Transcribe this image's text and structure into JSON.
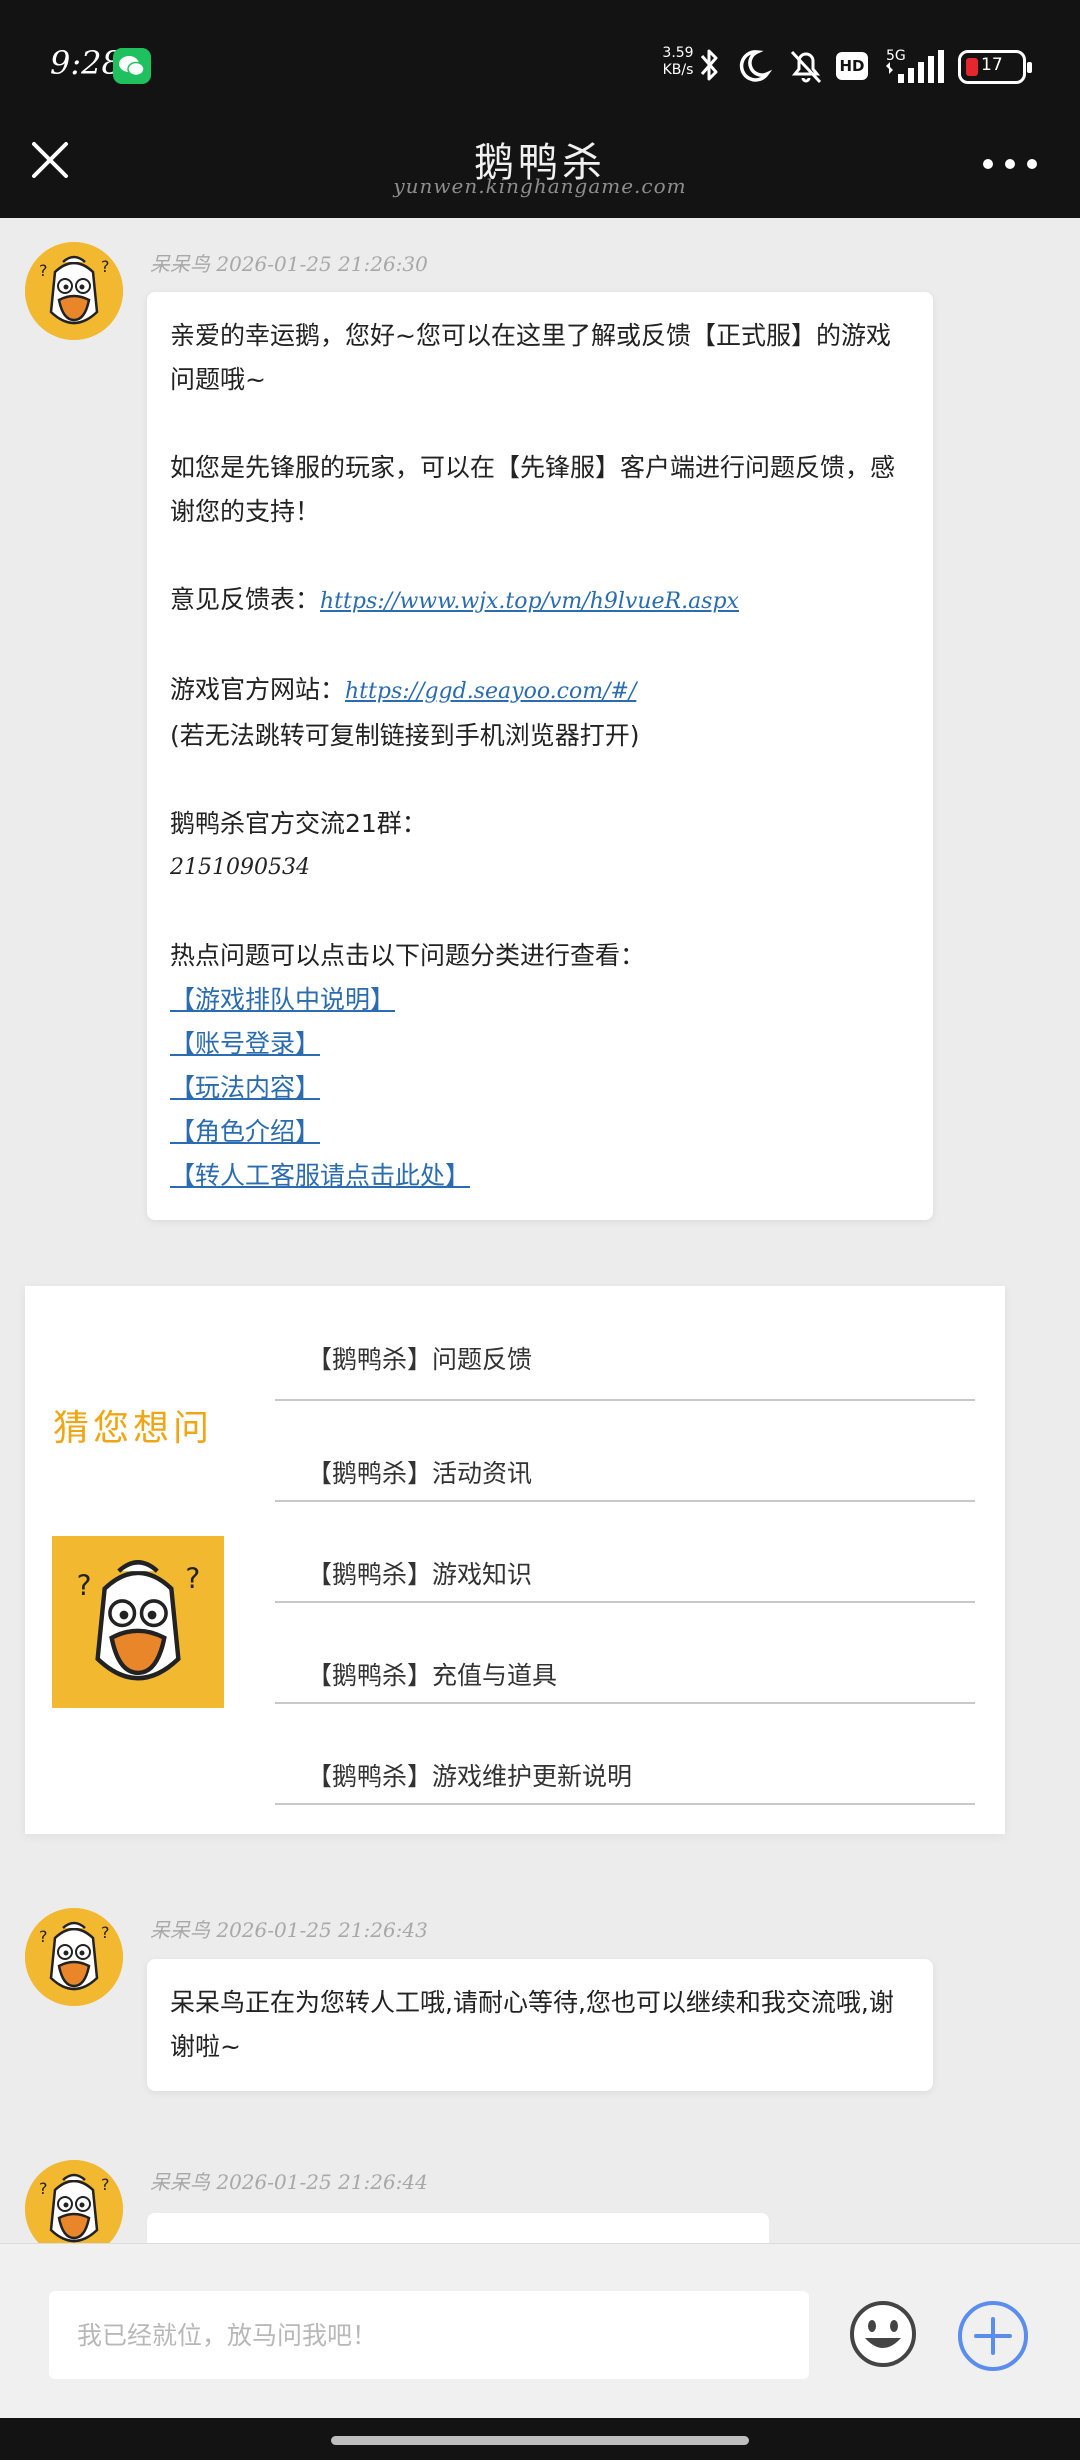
{
  "status_bar": {
    "time": "9:28",
    "net_speed_value": "3.59",
    "net_speed_unit": "KB/s",
    "hd_label": "HD",
    "network_label": "5G",
    "battery_level": "17"
  },
  "header": {
    "title": "鹅鸭杀",
    "subtitle": "yunwen.kinghangame.com"
  },
  "messages": [
    {
      "sender": "呆呆鸟",
      "timestamp": "2026-01-25 21:26:30",
      "intro": "亲爱的幸运鹅，您好~您可以在这里了解或反馈【正式服】的游戏问题哦~",
      "pioneer_note": "如您是先锋服的玩家，可以在【先锋服】客户端进行问题反馈，感谢您的支持！",
      "feedback_label": "意见反馈表：",
      "feedback_url": "https://www.wjx.top/vm/h9lvueR.aspx",
      "site_label": "游戏官方网站：",
      "site_url": "https://ggd.seayoo.com/#/",
      "site_note": "(若无法跳转可复制链接到手机浏览器打开)",
      "group_label": "鹅鸭杀官方交流21群：",
      "group_number": "2151090534",
      "hot_intro": "热点问题可以点击以下问题分类进行查看：",
      "hot_links": [
        "【游戏排队中说明】",
        "【账号登录】",
        "【玩法内容】",
        "【角色介绍】",
        "【转人工客服请点击此处】"
      ]
    },
    {
      "sender": "呆呆鸟",
      "timestamp": "2026-01-25 21:26:43",
      "text": "呆呆鸟正在为您转人工哦,请耐心等待,您也可以继续和我交流哦,谢谢啦~"
    },
    {
      "sender": "呆呆鸟",
      "timestamp": "2026-01-25 21:26:44"
    }
  ],
  "guess_card": {
    "title": "猜您想问",
    "items": [
      "【鹅鸭杀】问题反馈",
      "【鹅鸭杀】活动资讯",
      "【鹅鸭杀】游戏知识",
      "【鹅鸭杀】充值与道具",
      "【鹅鸭杀】游戏维护更新说明"
    ]
  },
  "input_bar": {
    "placeholder": "我已经就位，放马问我吧！"
  },
  "colors": {
    "header_bg": "#131313",
    "page_bg": "#ececec",
    "link": "#2b6cb0",
    "accent_orange": "#f0a514",
    "avatar_yellow": "#f2b830",
    "plus_blue": "#5b8def",
    "battery_red": "#e6262e",
    "wechat_green": "#1fc15f"
  },
  "icons": {
    "close": "close-icon",
    "more": "more-dots-icon",
    "emoji": "emoji-icon",
    "plus": "plus-icon",
    "avatar": "duck-avatar-icon"
  }
}
